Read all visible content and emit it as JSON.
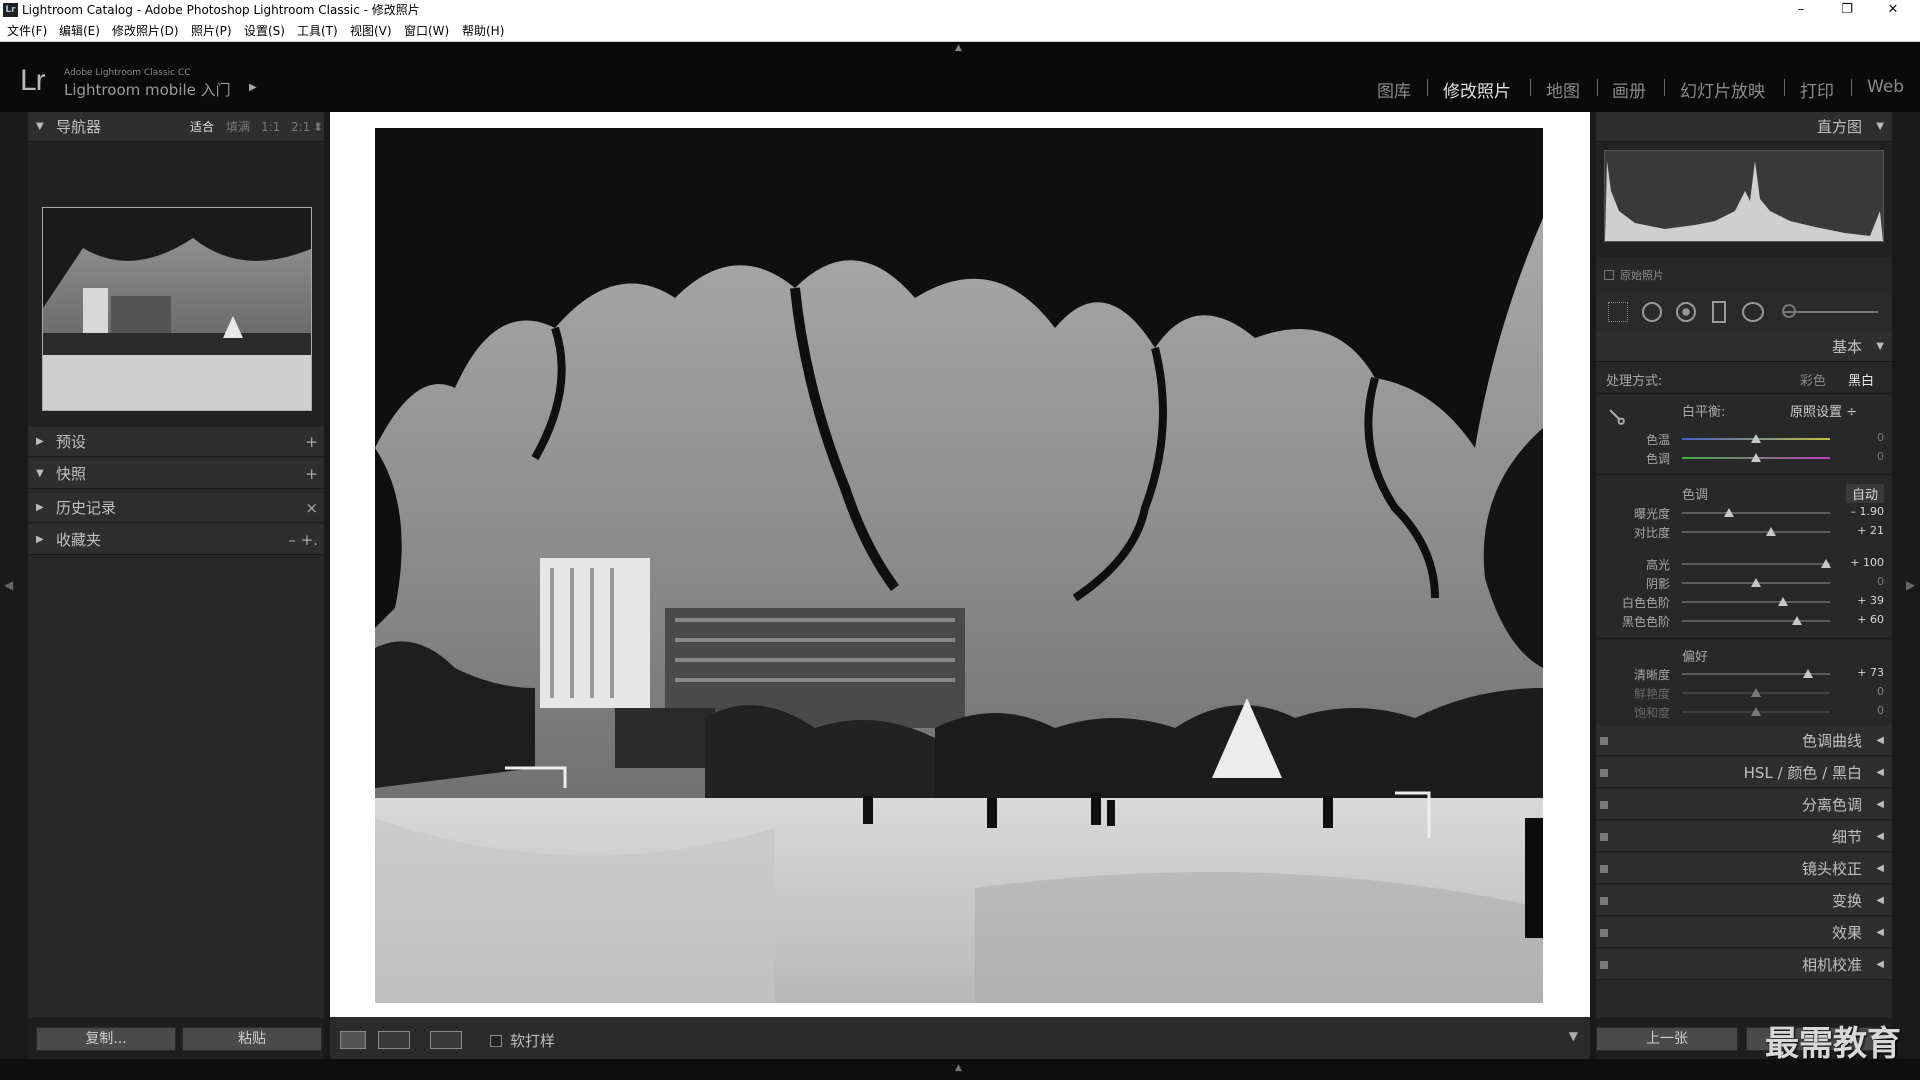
{
  "window": {
    "title": "Lightroom Catalog - Adobe Photoshop Lightroom Classic - 修改照片",
    "icon_text": "Lr",
    "min": "–",
    "max": "❐",
    "close": "✕"
  },
  "menu": [
    "文件(F)",
    "编辑(E)",
    "修改照片(D)",
    "照片(P)",
    "设置(S)",
    "工具(T)",
    "视图(V)",
    "窗口(W)",
    "帮助(H)"
  ],
  "identity": {
    "logo": "Lr",
    "app_name": "Adobe Lightroom Classic CC",
    "mobile": "Lightroom mobile 入门",
    "arrow": "▶"
  },
  "modules": [
    "图库",
    "修改照片",
    "地图",
    "画册",
    "幻灯片放映",
    "打印",
    "Web"
  ],
  "left": {
    "navigator": {
      "title": "导航器",
      "zoom": [
        "适合",
        "填满",
        "1:1",
        "2:1"
      ],
      "zoom_arrow": "⬍"
    },
    "panels": [
      {
        "label": "预设",
        "tri": "▶",
        "action": "+"
      },
      {
        "label": "快照",
        "tri": "▼",
        "action": "+"
      },
      {
        "label": "历史记录",
        "tri": "▶",
        "action": "×"
      },
      {
        "label": "收藏夹",
        "tri": "▶",
        "action": "–  +."
      }
    ],
    "copy_btn": "复制...",
    "paste_btn": "粘贴"
  },
  "toolbar": {
    "softproof": "软打样"
  },
  "right": {
    "histogram": {
      "title": "直方图",
      "original": "原始照片"
    },
    "basic": {
      "title": "基本",
      "treatment_label": "处理方式:",
      "color": "彩色",
      "bw": "黑白",
      "wb_label": "白平衡:",
      "wb_value": "原照设置 ÷",
      "tone_title": "色调",
      "auto": "自动",
      "presence_title": "偏好"
    },
    "sliders": [
      {
        "label": "色温",
        "value": "0",
        "pos": 0.5
      },
      {
        "label": "色调",
        "value": "0",
        "pos": 0.5
      },
      {
        "label": "曝光度",
        "value": "– 1.90",
        "pos": 0.32
      },
      {
        "label": "对比度",
        "value": "+ 21",
        "pos": 0.6
      },
      {
        "label": "高光",
        "value": "+ 100",
        "pos": 0.97
      },
      {
        "label": "阴影",
        "value": "0",
        "pos": 0.5
      },
      {
        "label": "白色色阶",
        "value": "+ 39",
        "pos": 0.68
      },
      {
        "label": "黑色色阶",
        "value": "+ 60",
        "pos": 0.78
      },
      {
        "label": "清晰度",
        "value": "+ 73",
        "pos": 0.85
      },
      {
        "label": "鲜艳度",
        "value": "0",
        "pos": 0.5
      },
      {
        "label": "饱和度",
        "value": "0",
        "pos": 0.5
      }
    ],
    "collapsed": [
      {
        "label": "色调曲线"
      },
      {
        "label": "HSL  /  颜色  /  黑白"
      },
      {
        "label": "分离色调"
      },
      {
        "label": "细节"
      },
      {
        "label": "镜头校正"
      },
      {
        "label": "变换"
      },
      {
        "label": "效果"
      },
      {
        "label": "相机校准"
      }
    ],
    "prev_btn": "上一张"
  },
  "watermark": "最需教育"
}
